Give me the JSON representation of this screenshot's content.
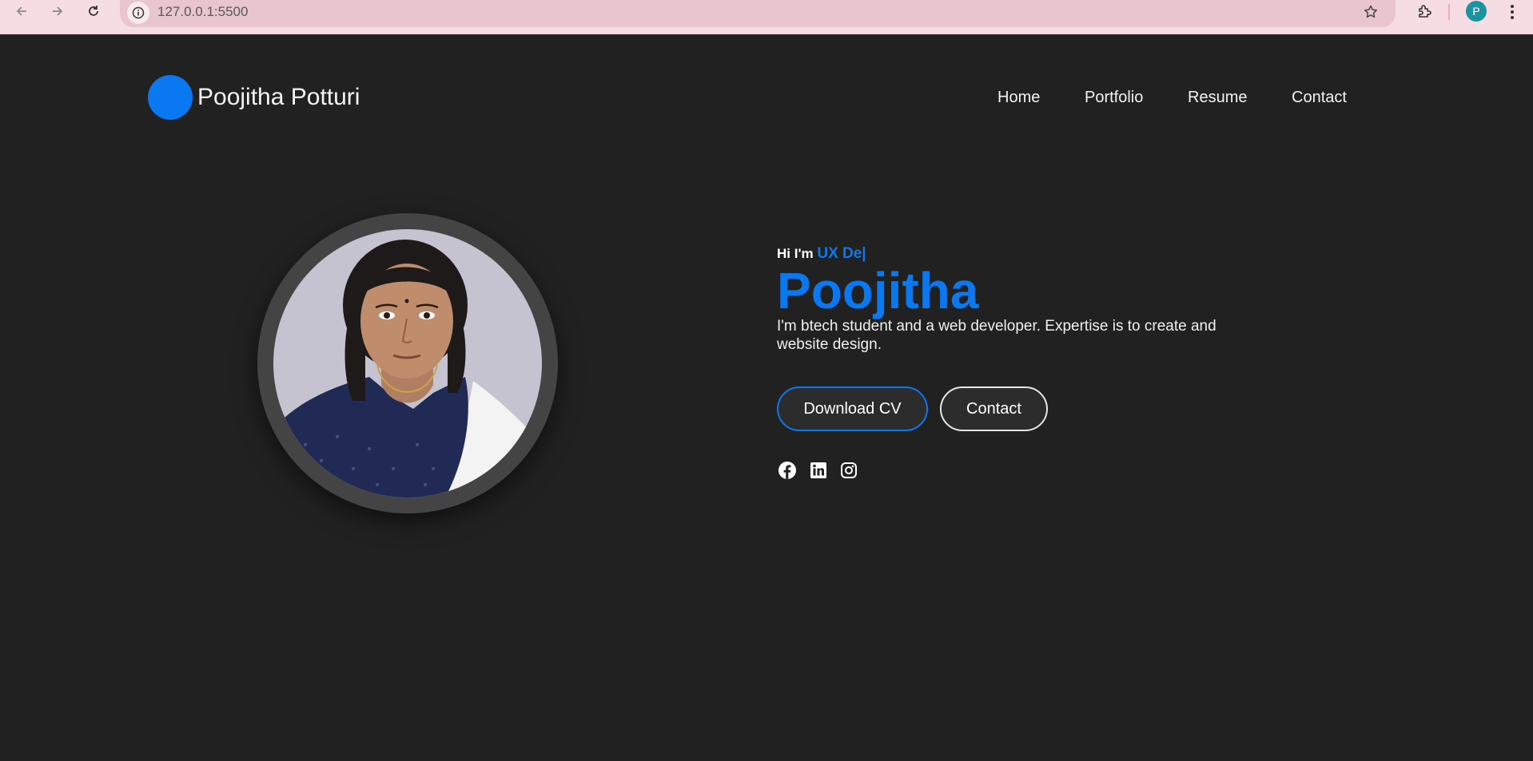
{
  "browser": {
    "url": "127.0.0.1:5500",
    "profile_initial": "P",
    "icons": [
      "back-icon",
      "forward-icon",
      "reload-icon",
      "info-icon",
      "star-icon",
      "extensions-icon",
      "menu-icon"
    ]
  },
  "header": {
    "brand_name": "Poojitha Potturi",
    "nav": [
      "Home",
      "Portfolio",
      "Resume",
      "Contact"
    ]
  },
  "hero": {
    "greeting": "Hi I'm",
    "typed_text": "UX De|",
    "name": "Poojitha",
    "description": "I'm btech student and a web developer. Expertise is to create and website design.",
    "buttons": {
      "download_cv": "Download CV",
      "contact": "Contact"
    },
    "socials": [
      "facebook-icon",
      "linkedin-icon",
      "instagram-icon"
    ]
  },
  "colors": {
    "accent": "#0a78f0",
    "background": "#212121",
    "browser_bar": "#f6dde3"
  }
}
